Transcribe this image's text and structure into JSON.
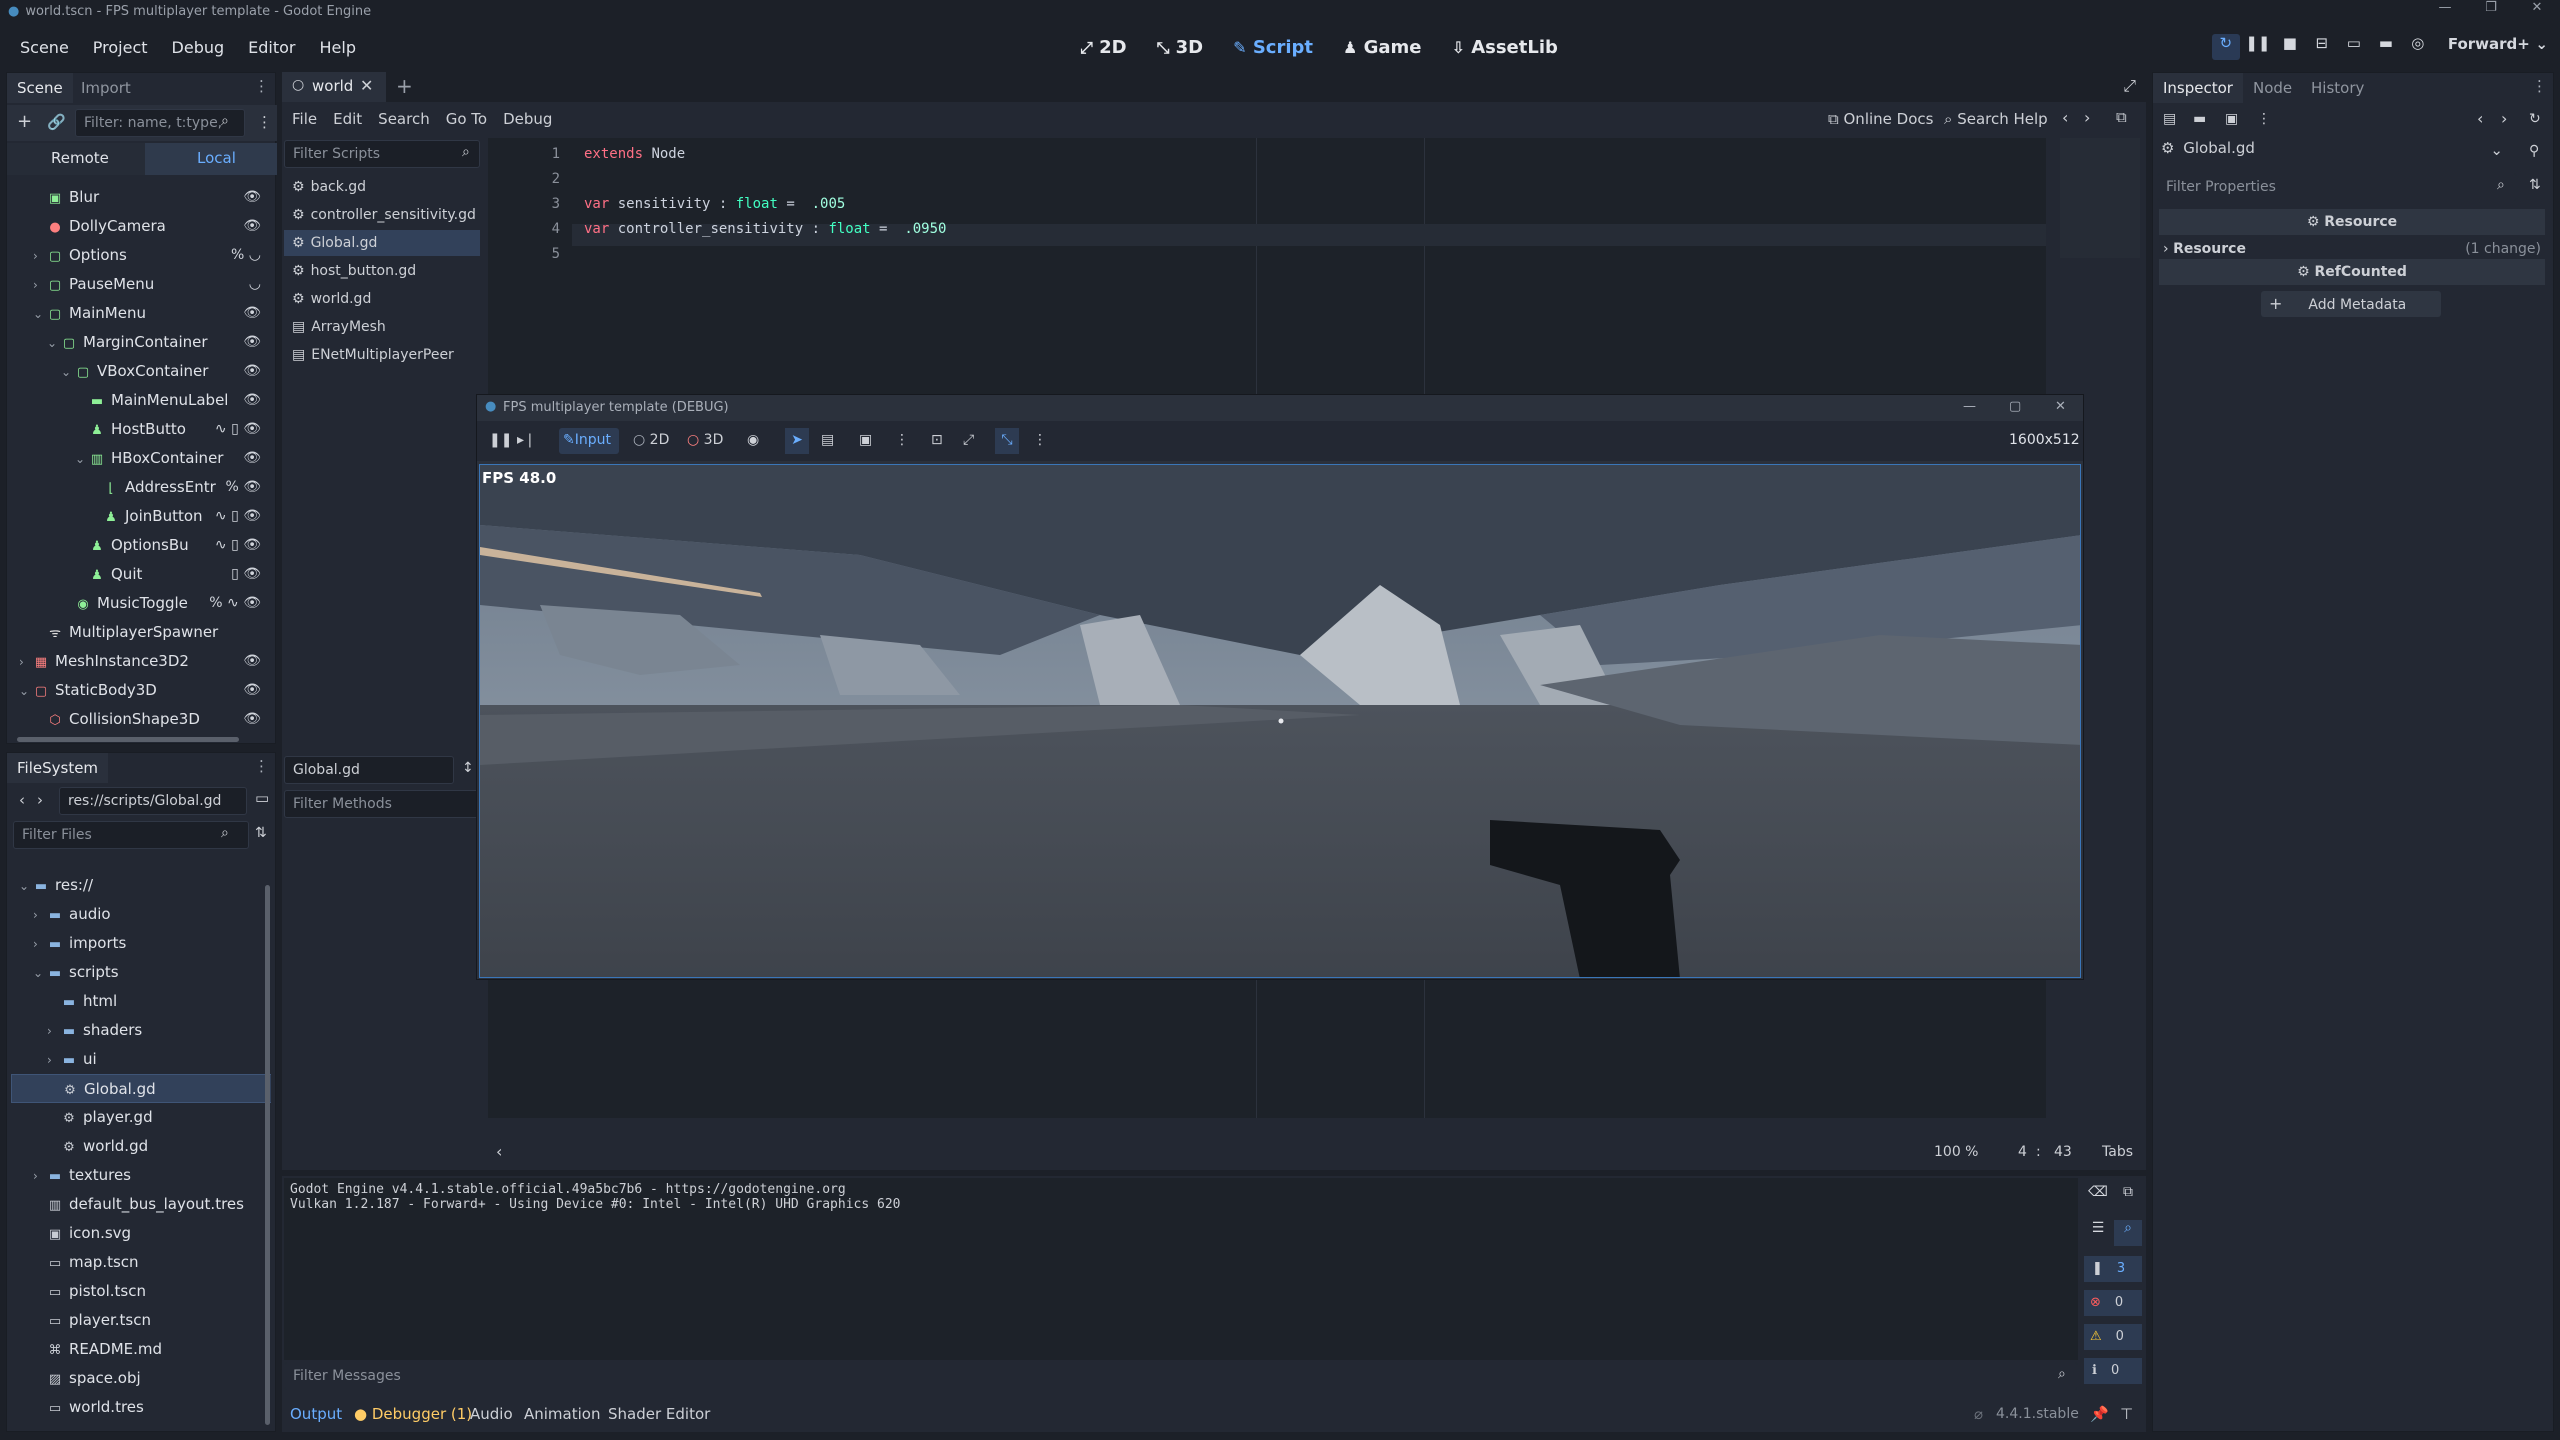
{
  "window": {
    "title": "world.tscn - FPS multiplayer template - Godot Engine",
    "controls": [
      "—",
      "❐",
      "✕"
    ]
  },
  "menu": [
    "Scene",
    "Project",
    "Debug",
    "Editor",
    "Help"
  ],
  "workspaces": [
    {
      "icon": "⤢",
      "label": "2D"
    },
    {
      "icon": "⤡",
      "label": "3D"
    },
    {
      "icon": "✎",
      "label": "Script"
    },
    {
      "icon": "♟",
      "label": "Game"
    },
    {
      "icon": "⇩",
      "label": "AssetLib"
    }
  ],
  "renderer": "Forward+",
  "scene_dock": {
    "tabs": [
      "Scene",
      "Import"
    ],
    "filter_placeholder": "Filter: name, t:type,",
    "remote": "Remote",
    "local": "Local",
    "nodes": [
      {
        "label": "Blur",
        "indent": 1,
        "icon": "▣",
        "color": "#8eef97",
        "right": "👁"
      },
      {
        "label": "DollyCamera",
        "indent": 1,
        "icon": "●",
        "color": "#fc7f7f",
        "right": "👁"
      },
      {
        "label": "Options",
        "indent": 1,
        "icon": "▢",
        "color": "#8eef97",
        "arrow": "›",
        "right": "% ◡"
      },
      {
        "label": "PauseMenu",
        "indent": 1,
        "icon": "▢",
        "color": "#8eef97",
        "arrow": "›",
        "right": "◡"
      },
      {
        "label": "MainMenu",
        "indent": 1,
        "icon": "▢",
        "color": "#8eef97",
        "arrow": "⌄",
        "right": "👁"
      },
      {
        "label": "MarginContainer",
        "indent": 2,
        "icon": "▢",
        "color": "#8eef97",
        "arrow": "⌄",
        "right": "👁"
      },
      {
        "label": "VBoxContainer",
        "indent": 3,
        "icon": "▢",
        "color": "#8eef97",
        "arrow": "⌄",
        "right": "👁"
      },
      {
        "label": "MainMenuLabel",
        "indent": 4,
        "icon": "▬",
        "color": "#8eef97",
        "right": "👁"
      },
      {
        "label": "HostButto",
        "indent": 4,
        "icon": "♟",
        "color": "#8eef97",
        "right": "∿ ▯ 👁"
      },
      {
        "label": "HBoxContainer",
        "indent": 4,
        "icon": "▥",
        "color": "#8eef97",
        "arrow": "⌄",
        "right": "👁"
      },
      {
        "label": "AddressEntr",
        "indent": 5,
        "icon": "⌊",
        "color": "#8eef97",
        "right": "% 👁"
      },
      {
        "label": "JoinButton",
        "indent": 5,
        "icon": "♟",
        "color": "#8eef97",
        "right": "∿ ▯ 👁"
      },
      {
        "label": "OptionsBu",
        "indent": 4,
        "icon": "♟",
        "color": "#8eef97",
        "right": "∿ ▯ 👁"
      },
      {
        "label": "Quit",
        "indent": 4,
        "icon": "♟",
        "color": "#8eef97",
        "right": "▯ 👁"
      },
      {
        "label": "MusicToggle",
        "indent": 3,
        "icon": "◉",
        "color": "#8eef97",
        "right": "% ∿ 👁"
      },
      {
        "label": "MultiplayerSpawner",
        "indent": 1,
        "icon": "ᯤ",
        "color": "#e0e0e0",
        "right": ""
      },
      {
        "label": "MeshInstance3D2",
        "indent": 0,
        "icon": "▦",
        "color": "#fc7f7f",
        "arrow": "›",
        "right": "👁"
      },
      {
        "label": "StaticBody3D",
        "indent": 0,
        "icon": "▢",
        "color": "#fc7f7f",
        "arrow": "⌄",
        "right": "👁"
      },
      {
        "label": "CollisionShape3D",
        "indent": 1,
        "icon": "⬡",
        "color": "#fc7f7f",
        "right": "👁"
      }
    ]
  },
  "filesystem": {
    "tab": "FileSystem",
    "path": "res://scripts/Global.gd",
    "filter_placeholder": "Filter Files",
    "items": [
      {
        "label": "res://",
        "indent": 0,
        "icon": "▬",
        "arrow": "⌄"
      },
      {
        "label": "audio",
        "indent": 1,
        "icon": "▬",
        "arrow": "›"
      },
      {
        "label": "imports",
        "indent": 1,
        "icon": "▬",
        "arrow": "›"
      },
      {
        "label": "scripts",
        "indent": 1,
        "icon": "▬",
        "arrow": "⌄"
      },
      {
        "label": "html",
        "indent": 2,
        "icon": "▬"
      },
      {
        "label": "shaders",
        "indent": 2,
        "icon": "▬",
        "arrow": "›"
      },
      {
        "label": "ui",
        "indent": 2,
        "icon": "▬",
        "arrow": "›"
      },
      {
        "label": "Global.gd",
        "indent": 2,
        "icon": "⚙",
        "selected": true
      },
      {
        "label": "player.gd",
        "indent": 2,
        "icon": "⚙"
      },
      {
        "label": "world.gd",
        "indent": 2,
        "icon": "⚙"
      },
      {
        "label": "textures",
        "indent": 1,
        "icon": "▬",
        "arrow": "›"
      },
      {
        "label": "default_bus_layout.tres",
        "indent": 1,
        "icon": "▥"
      },
      {
        "label": "icon.svg",
        "indent": 1,
        "icon": "▣"
      },
      {
        "label": "map.tscn",
        "indent": 1,
        "icon": "▭"
      },
      {
        "label": "pistol.tscn",
        "indent": 1,
        "icon": "▭"
      },
      {
        "label": "player.tscn",
        "indent": 1,
        "icon": "▭"
      },
      {
        "label": "README.md",
        "indent": 1,
        "icon": "⌘"
      },
      {
        "label": "space.obj",
        "indent": 1,
        "icon": "▨"
      },
      {
        "label": "world.tres",
        "indent": 1,
        "icon": "▭"
      }
    ]
  },
  "editor": {
    "scene_tab": "world",
    "menu": [
      "File",
      "Edit",
      "Search",
      "Go To",
      "Debug"
    ],
    "online_docs": "Online Docs",
    "search_help": "Search Help",
    "filter_scripts": "Filter Scripts",
    "scripts": [
      "back.gd",
      "controller_sensitivity.gd",
      "Global.gd",
      "host_button.gd",
      "world.gd",
      "ArrayMesh",
      "ENetMultiplayerPeer"
    ],
    "current_script": "Global.gd",
    "filter_methods": "Filter Methods",
    "lines": [
      "1",
      "2",
      "3",
      "4",
      "5"
    ],
    "code": {
      "l1_kw": "extends",
      "l1_rest": " Node",
      "l3_kw": "var",
      "l3_name": " sensitivity : ",
      "l3_type": "float",
      "l3_eq": " =  ",
      "l3_val": ".005",
      "l4_kw": "var",
      "l4_name": " controller_sensitivity : ",
      "l4_type": "float",
      "l4_eq": " =  ",
      "l4_val": ".0950"
    },
    "zoom": "100 %",
    "cursor_line": "4",
    "cursor_col": "43",
    "indent": "Tabs"
  },
  "debug_window": {
    "title": "FPS multiplayer template (DEBUG)",
    "input": "Input",
    "mode_2d": "2D",
    "mode_3d": "3D",
    "resolution": "1600x512",
    "fps": "FPS 48.0"
  },
  "inspector": {
    "tabs": [
      "Inspector",
      "Node",
      "History"
    ],
    "resource_name": "Global.gd",
    "filter_placeholder": "Filter Properties",
    "section_resource": "Resource",
    "resource_row": "Resource",
    "changes": "(1 change)",
    "section_refcounted": "RefCounted",
    "add_metadata": "Add Metadata"
  },
  "output": {
    "lines": [
      "Godot Engine v4.4.1.stable.official.49a5bc7b6 - https://godotengine.org",
      "Vulkan 1.2.187 - Forward+ - Using Device #0: Intel - Intel(R) UHD Graphics 620"
    ],
    "filter_placeholder": "Filter Messages",
    "counts": {
      "messages": "3",
      "errors": "0",
      "warnings": "0",
      "info": "0"
    }
  },
  "bottom_tabs": [
    "Output",
    "Debugger (1)",
    "Audio",
    "Animation",
    "Shader Editor"
  ],
  "version": "4.4.1.stable",
  "colors": {
    "accent": "#6aaeff",
    "keyword": "#ff7085",
    "type": "#42ffc2",
    "number": "#a1ffe0",
    "forward": "#8cc665"
  }
}
